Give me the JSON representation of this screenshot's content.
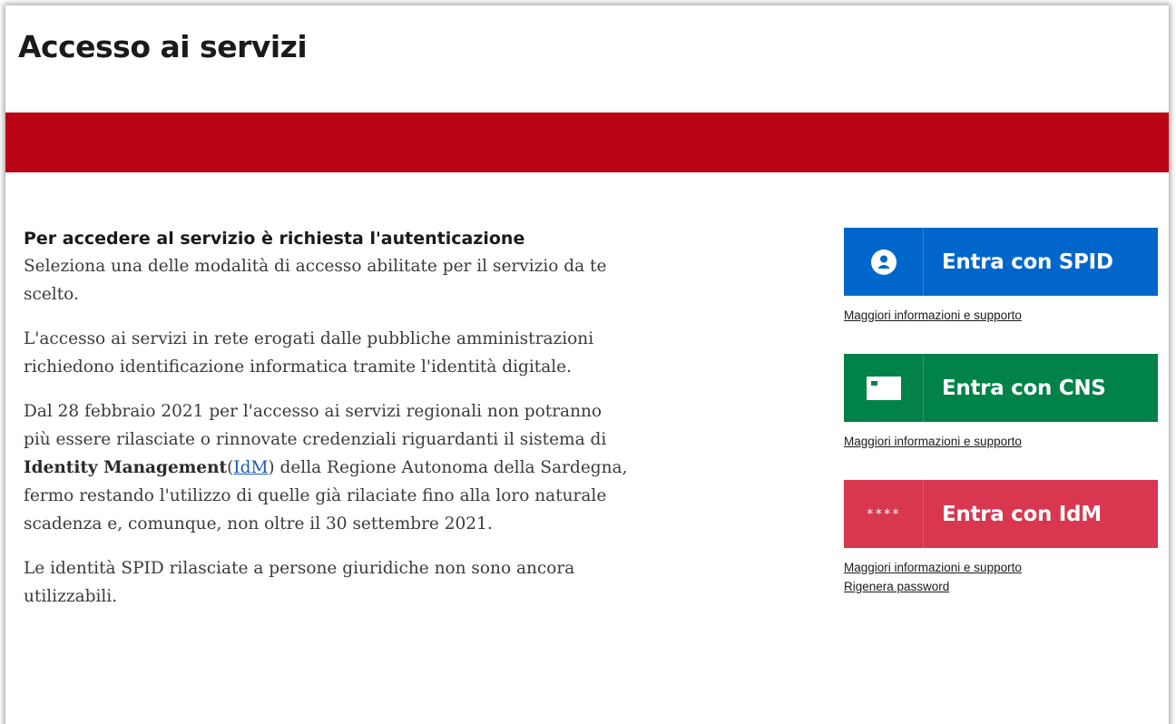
{
  "page": {
    "title": "Accesso ai servizi"
  },
  "colors": {
    "band": "#bb0516",
    "spid": "#0066cc",
    "cns": "#008248",
    "idm": "#d9364f",
    "link": "#1a5bb8"
  },
  "content": {
    "heading": "Per accedere al servizio è richiesta l'autenticazione",
    "p1": "Seleziona una delle modalità di accesso abilitate per il servizio da te scelto.",
    "p2": "L'accesso ai servizi in rete erogati dalle pubbliche amministrazioni richiedono identificazione informatica tramite l'identità digitale.",
    "p3_before": "Dal 28 febbraio 2021 per l'accesso ai servizi regionali non potranno più essere rilasciate o rinnovate credenziali riguardanti il sistema di ",
    "p3_bold": "Identity Management",
    "p3_paren_open": "(",
    "p3_link": "IdM",
    "p3_paren_close": ")",
    "p3_after": " della Regione Autonoma della Sardegna, fermo restando l'utilizzo di quelle già rilaciate fino alla loro naturale scadenza e, comunque, non oltre il 30 settembre 2021.",
    "p4": "Le identità SPID rilasciate a persone giuridiche non sono ancora utilizzabili."
  },
  "login": {
    "spid": {
      "label": "Entra con SPID",
      "icon": "user-circle-icon",
      "support": "Maggiori informazioni e supporto"
    },
    "cns": {
      "label": "Entra con CNS",
      "icon": "smart-card-icon",
      "support": "Maggiori informazioni e supporto"
    },
    "idm": {
      "label": "Entra con IdM",
      "icon_text": "****",
      "support": "Maggiori informazioni e supporto",
      "regenerate": "Rigenera password"
    }
  }
}
